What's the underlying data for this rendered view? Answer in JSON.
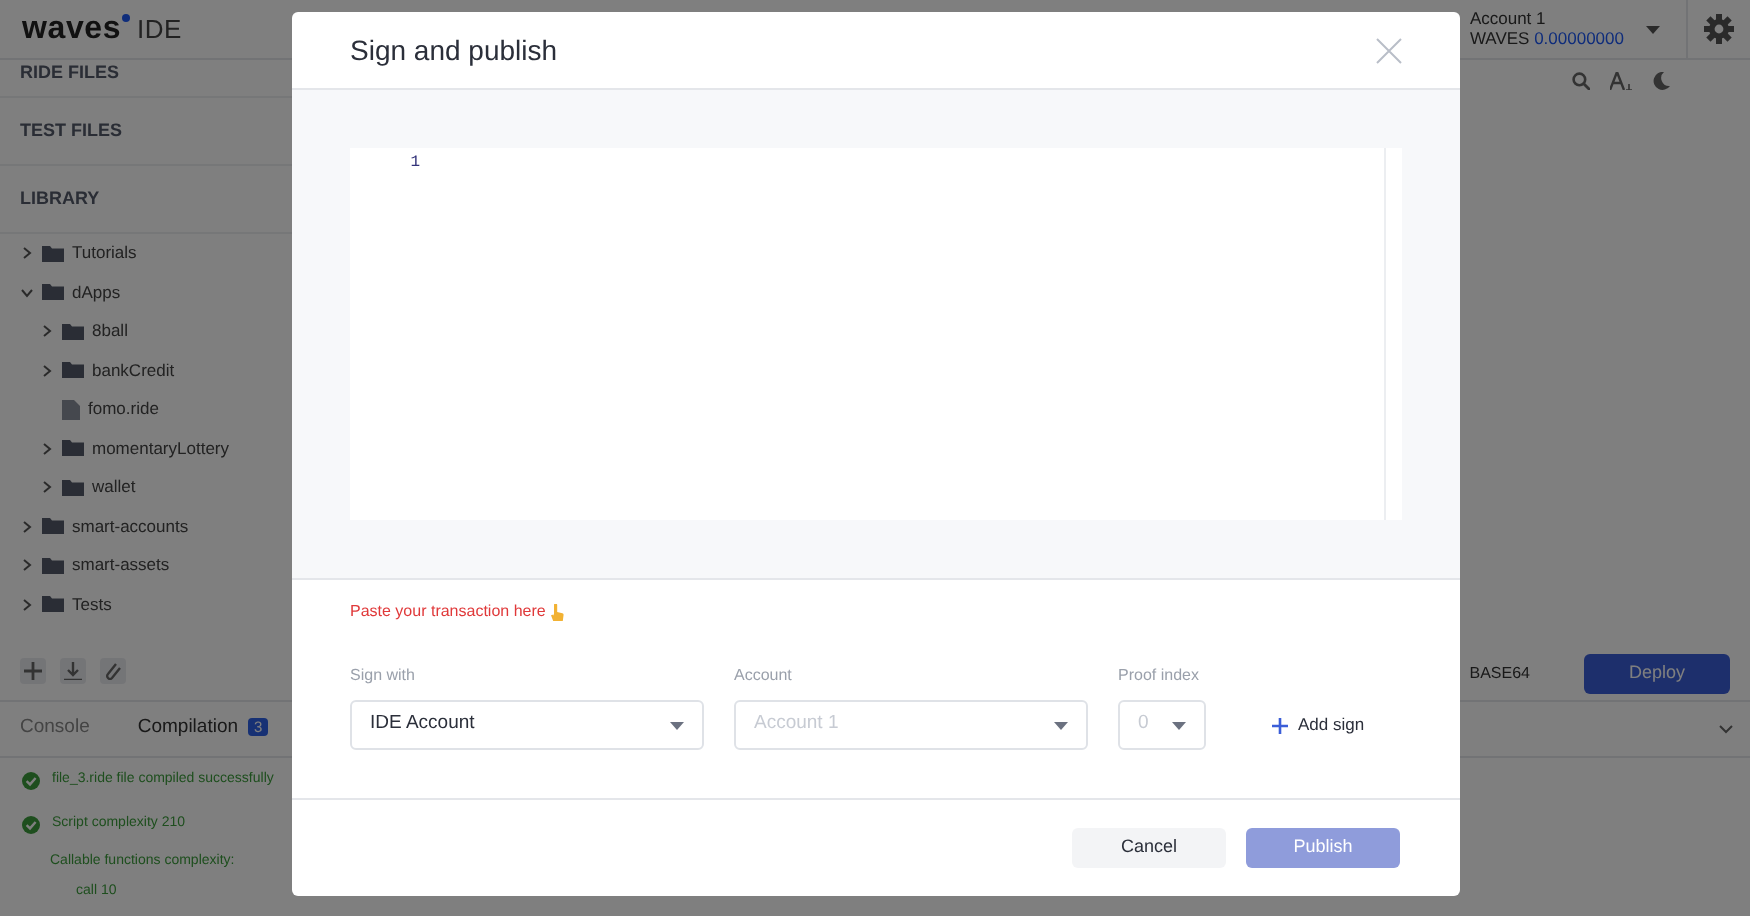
{
  "header": {
    "logo": "waves",
    "logo_suffix": "IDE",
    "account": {
      "name": "Account 1",
      "currency": "WAVES",
      "balance": "0.00000000"
    }
  },
  "sidebar": {
    "sections": [
      {
        "title": "RIDE FILES"
      },
      {
        "title": "TEST FILES"
      },
      {
        "title": "LIBRARY"
      }
    ],
    "tree": [
      {
        "label": "Tutorials",
        "kind": "folder",
        "expanded": false
      },
      {
        "label": "dApps",
        "kind": "folder",
        "expanded": true,
        "children": [
          {
            "label": "8ball",
            "kind": "folder",
            "expanded": false
          },
          {
            "label": "bankCredit",
            "kind": "folder",
            "expanded": false
          },
          {
            "label": "fomo.ride",
            "kind": "file"
          },
          {
            "label": "momentaryLottery",
            "kind": "folder",
            "expanded": false
          },
          {
            "label": "wallet",
            "kind": "folder",
            "expanded": false
          }
        ]
      },
      {
        "label": "smart-accounts",
        "kind": "folder",
        "expanded": false
      },
      {
        "label": "smart-assets",
        "kind": "folder",
        "expanded": false
      },
      {
        "label": "Tests",
        "kind": "folder",
        "expanded": false
      }
    ]
  },
  "editor_footer": {
    "format": "BASE64",
    "deploy": "Deploy"
  },
  "bottom_panel": {
    "tabs": [
      {
        "label": "Console",
        "selected": false
      },
      {
        "label": "Compilation",
        "selected": true,
        "badge": "3"
      }
    ],
    "log": [
      {
        "text": "file_3.ride file compiled successfully",
        "kind": "success"
      },
      {
        "text": "Script complexity 210",
        "kind": "success"
      },
      {
        "text": "Callable functions complexity:",
        "kind": "detail"
      },
      {
        "text": "call 10",
        "kind": "subdetail"
      }
    ]
  },
  "modal": {
    "title": "Sign and publish",
    "editor": {
      "line_numbers": [
        "1"
      ]
    },
    "hint": "Paste your transaction here",
    "fields": [
      {
        "label": "Sign with",
        "value": "IDE Account",
        "disabled": false
      },
      {
        "label": "Account",
        "value": "Account 1",
        "disabled": true
      },
      {
        "label": "Proof index",
        "value": "0",
        "disabled": true
      }
    ],
    "add_sign": "Add sign",
    "buttons": [
      {
        "label": "Cancel",
        "kind": "secondary",
        "disabled": false
      },
      {
        "label": "Publish",
        "kind": "primary",
        "disabled": true
      }
    ]
  }
}
